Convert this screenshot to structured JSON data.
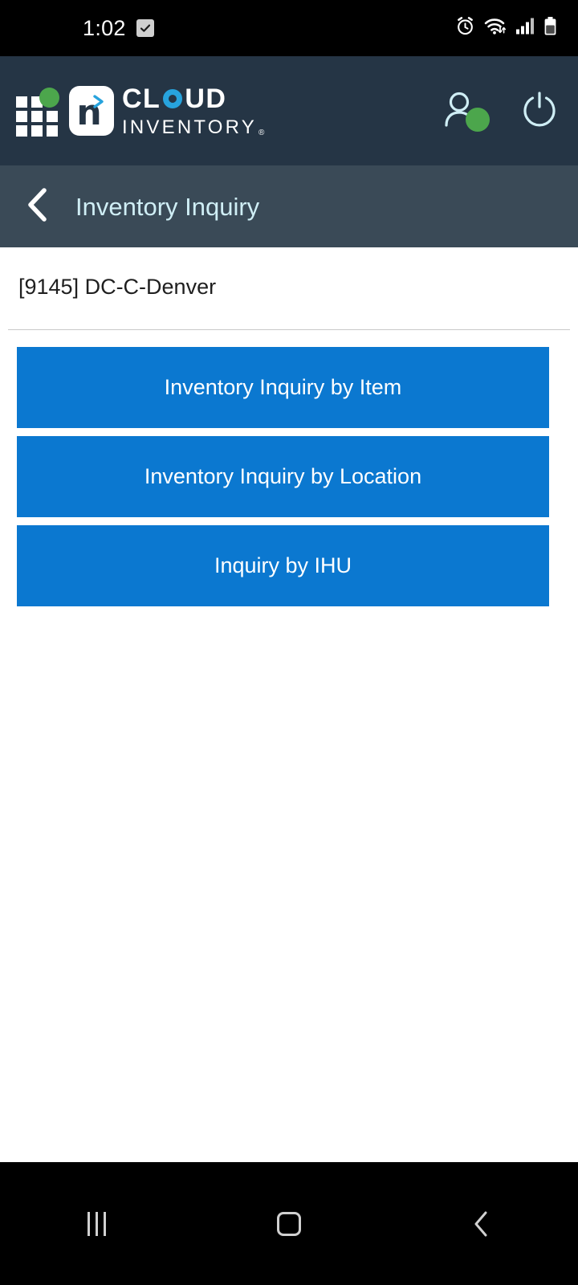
{
  "statusbar": {
    "time": "1:02",
    "notification_icon": "checkbox-check-icon",
    "icons": [
      "alarm-icon",
      "wifi-icon",
      "signal-icon",
      "battery-icon"
    ]
  },
  "header": {
    "grid_icon": "app-grid-icon",
    "logo_letter": "n",
    "logo_brand_line1": "CLOUD",
    "logo_brand_line1_parts": [
      "CL",
      "O",
      "UD"
    ],
    "logo_brand_line2": "INVENTORY",
    "logo_trademark": "®",
    "user_icon": "user-account-icon",
    "power_icon": "power-icon",
    "bg_color": "#253545",
    "accent_green": "#4ca64c",
    "accent_blue": "#27a3dd"
  },
  "titlebar": {
    "back_icon": "back-chevron-icon",
    "title": "Inventory Inquiry",
    "bg_color": "#3a4a57",
    "title_color": "#cfeef5"
  },
  "content": {
    "location": "[9145] DC-C-Denver",
    "buttons": [
      {
        "label": "Inventory Inquiry by Item"
      },
      {
        "label": "Inventory Inquiry by Location"
      },
      {
        "label": "Inquiry by IHU"
      }
    ],
    "button_color": "#0b78d0"
  },
  "navbar": {
    "recents_icon": "recents-icon",
    "home_icon": "home-icon",
    "back_icon": "nav-back-icon"
  }
}
